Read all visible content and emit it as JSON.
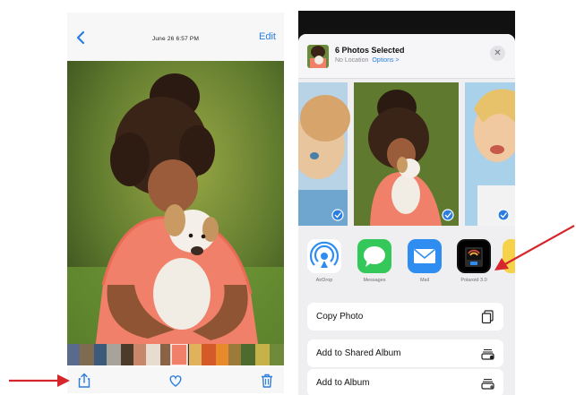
{
  "photos_viewer": {
    "timestamp": "June 26 6:57 PM",
    "edit_label": "Edit",
    "icons": {
      "back": "chevron-left-icon",
      "share": "share-icon",
      "favorite": "heart-icon",
      "delete": "trash-icon"
    }
  },
  "share_sheet": {
    "title": "6 Photos Selected",
    "location": "No Location",
    "options_label": "Options >",
    "close_symbol": "✕",
    "apps": [
      {
        "label": "AirDrop",
        "icon": "airdrop-icon",
        "color": "#ffffff"
      },
      {
        "label": "Messages",
        "icon": "messages-icon",
        "color": "#34c759"
      },
      {
        "label": "Mail",
        "icon": "mail-icon",
        "color": "#2f8cf0"
      },
      {
        "label": "Polaroid 3.0",
        "icon": "polaroid-icon",
        "color": "#000000"
      }
    ],
    "actions": [
      {
        "label": "Copy Photo",
        "icon": "copy-icon"
      },
      {
        "label": "Add to Shared Album",
        "icon": "shared-album-icon"
      },
      {
        "label": "Add to Album",
        "icon": "album-icon"
      }
    ]
  },
  "colors": {
    "accent_blue": "#2a7de1",
    "annotation_red": "#d7262b",
    "checkmark_blue": "#2a7de1"
  }
}
